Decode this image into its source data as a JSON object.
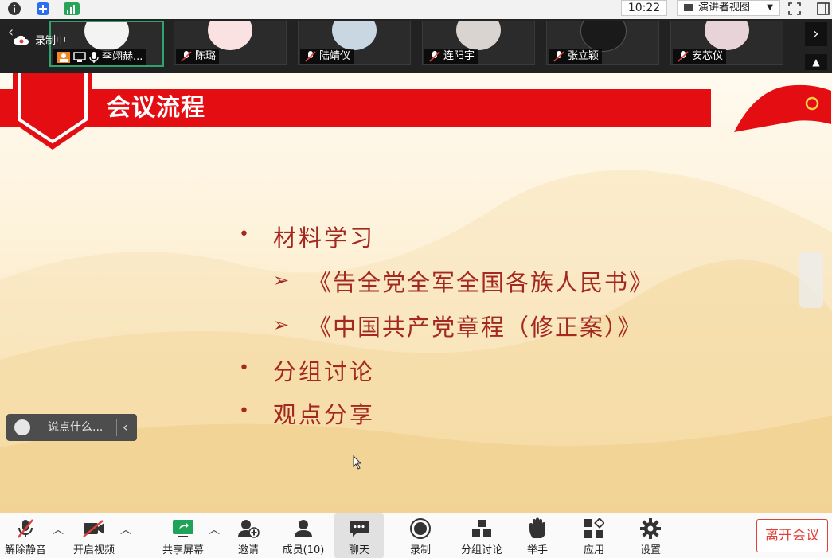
{
  "system_bar": {
    "clock": "10:22",
    "view_mode": "演讲者视图"
  },
  "recording": {
    "label": "录制中"
  },
  "participants": [
    {
      "name": "李翊赫..."
    },
    {
      "name": "陈璐"
    },
    {
      "name": "陆靖仪"
    },
    {
      "name": "连阳宇"
    },
    {
      "name": "张立颖"
    },
    {
      "name": "安芯仪"
    }
  ],
  "slide": {
    "title": "会议流程",
    "bullets": [
      {
        "text": "材料学习",
        "level": 1
      },
      {
        "text": "《告全党全军全国各族人民书》",
        "level": 2
      },
      {
        "text": "《中国共产党章程（修正案）》",
        "level": 2
      },
      {
        "text": "分组讨论",
        "level": 1
      },
      {
        "text": "观点分享",
        "level": 1
      }
    ],
    "bullet_symbol": "•",
    "sub_bullet_symbol": "➢"
  },
  "chat_box": {
    "placeholder": "说点什么..."
  },
  "toolbar": {
    "unmute": "解除静音",
    "start_video": "开启视频",
    "share_screen": "共享屏幕",
    "invite": "邀请",
    "members": "成员(10)",
    "chat": "聊天",
    "record": "录制",
    "breakout": "分组讨论",
    "raise_hand": "举手",
    "apps": "应用",
    "settings": "设置",
    "leave": "离开会议"
  },
  "colors": {
    "banner_red": "#e40e12",
    "bullet_text": "#a42820",
    "share_green": "#1fa35a",
    "leave_red": "#e0403a"
  }
}
